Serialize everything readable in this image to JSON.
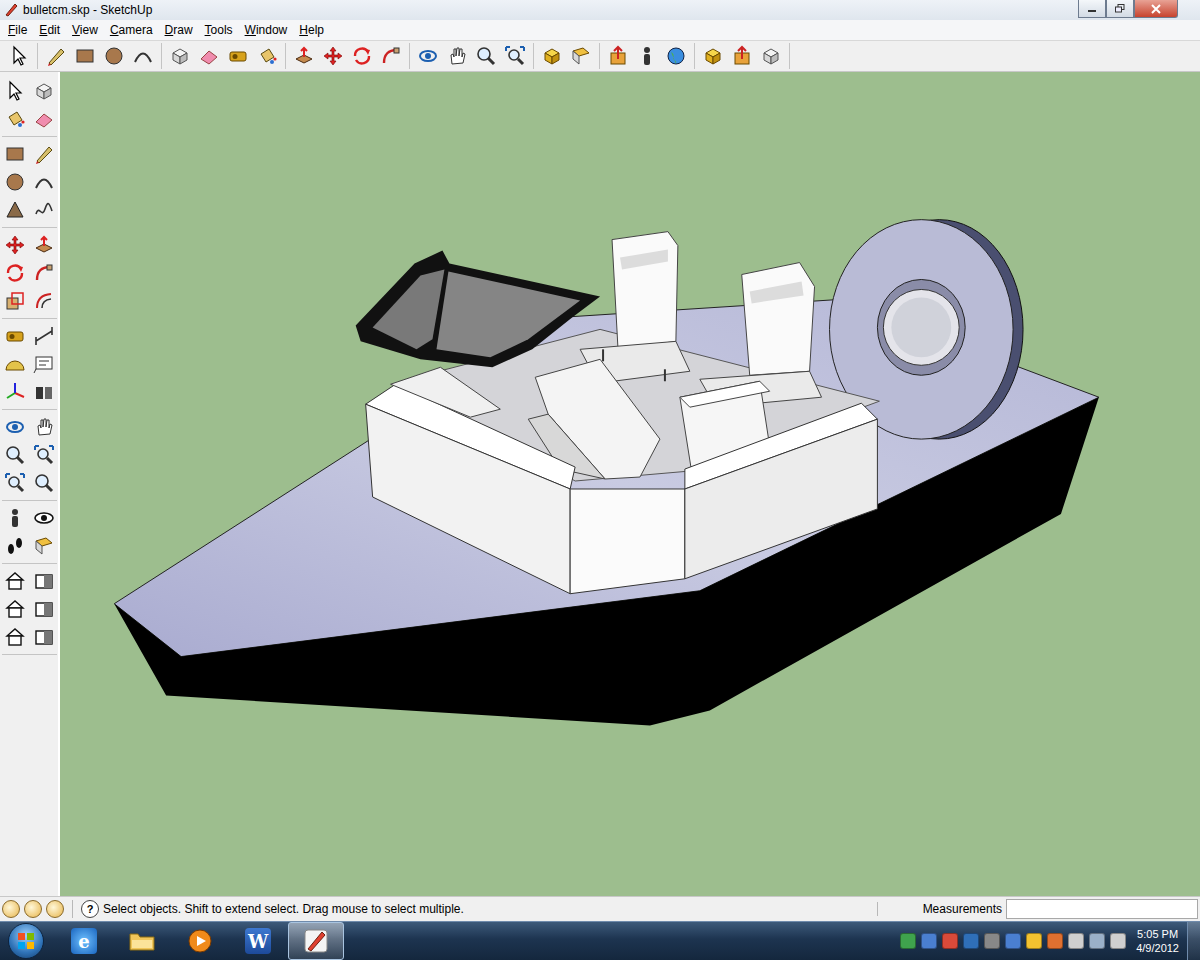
{
  "window": {
    "title": "bulletcm.skp - SketchUp"
  },
  "menu": [
    "File",
    "Edit",
    "View",
    "Camera",
    "Draw",
    "Tools",
    "Window",
    "Help"
  ],
  "status_bar": {
    "help_glyph": "?",
    "hint": "Select objects. Shift to extend select. Drag mouse to select multiple.",
    "measurements_label": "Measurements"
  },
  "taskbar": {
    "apps": [
      {
        "kind": "ie",
        "glyph": "e",
        "selected": false
      },
      {
        "kind": "explorer",
        "glyph": "",
        "selected": false
      },
      {
        "kind": "media",
        "glyph": "",
        "selected": false
      },
      {
        "kind": "word",
        "glyph": "W",
        "selected": false
      },
      {
        "kind": "sketchup",
        "glyph": "",
        "selected": true
      }
    ],
    "clock": {
      "time": "5:05 PM",
      "date": "4/9/2012"
    }
  }
}
